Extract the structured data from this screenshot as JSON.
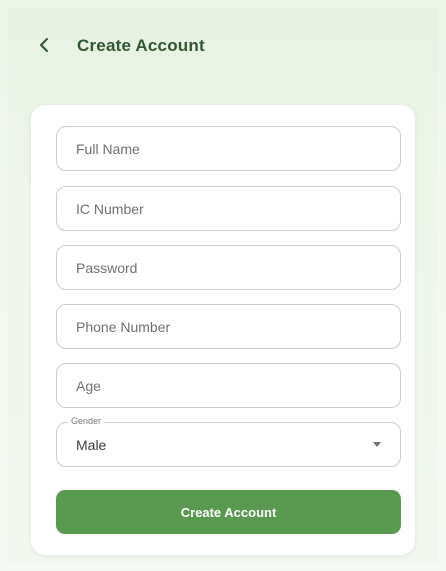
{
  "header": {
    "title": "Create Account",
    "back_icon": "chevron-left-icon"
  },
  "form": {
    "full_name_placeholder": "Full Name",
    "ic_number_placeholder": "IC Number",
    "password_placeholder": "Password",
    "phone_placeholder": "Phone Number",
    "age_placeholder": "Age",
    "gender": {
      "label": "Gender",
      "value": "Male"
    },
    "submit_label": "Create Account"
  },
  "colors": {
    "accent": "#5a9a50",
    "title": "#2f5730",
    "background": "#eef6ea"
  }
}
